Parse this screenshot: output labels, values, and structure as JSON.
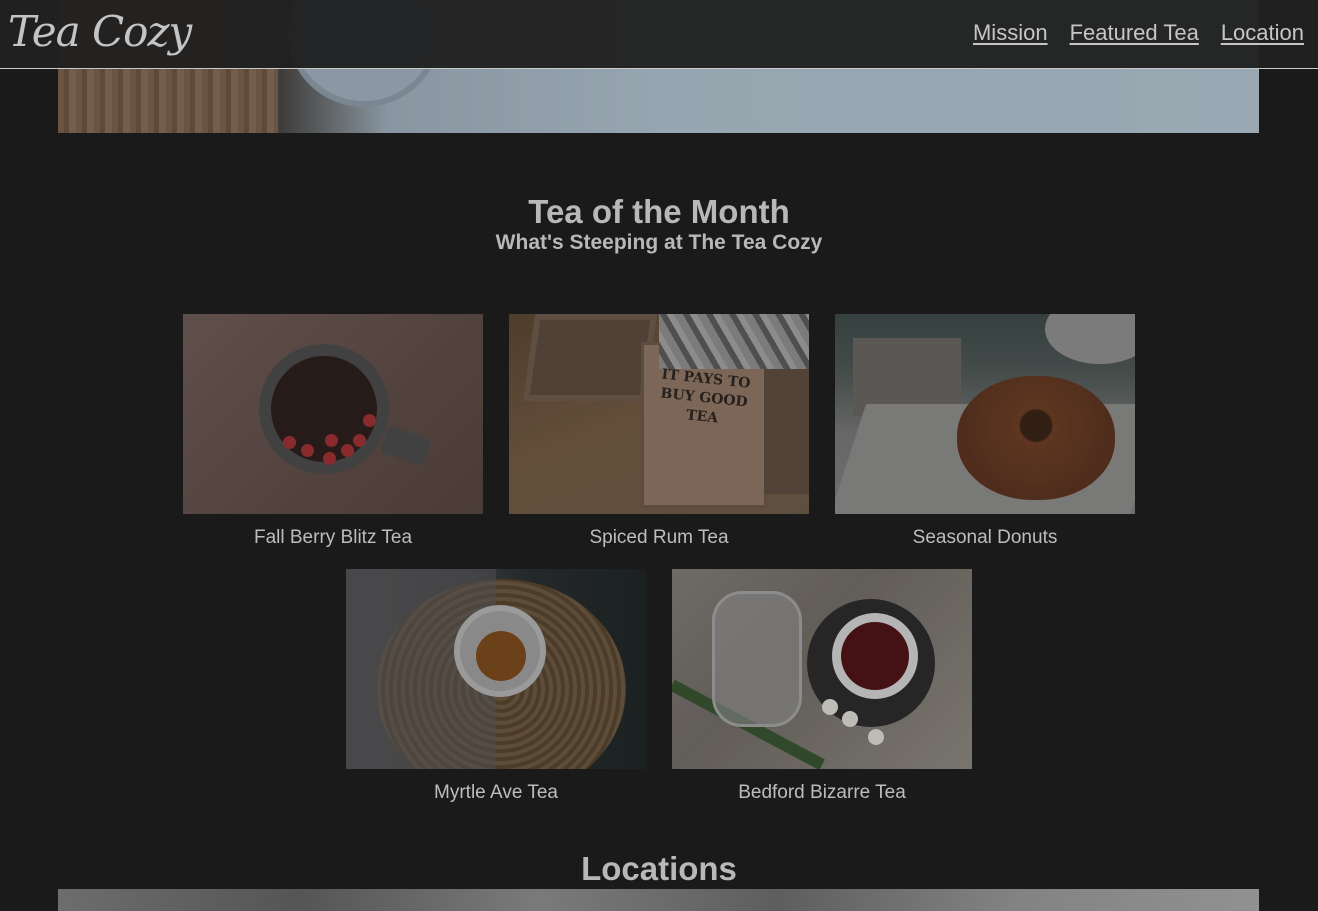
{
  "header": {
    "logo": "Tea Cozy",
    "nav": [
      {
        "label": "Mission"
      },
      {
        "label": "Featured Tea"
      },
      {
        "label": "Location"
      }
    ]
  },
  "tea_of_month": {
    "title": "Tea of the Month",
    "subtitle": "What's Steeping at The Tea Cozy",
    "items": [
      {
        "caption": "Fall Berry Blitz Tea"
      },
      {
        "caption": "Spiced Rum Tea",
        "box_text": "IT PAYS TO BUY GOOD TEA"
      },
      {
        "caption": "Seasonal Donuts"
      },
      {
        "caption": "Myrtle Ave Tea"
      },
      {
        "caption": "Bedford Bizarre Tea"
      }
    ]
  },
  "locations": {
    "title": "Locations"
  },
  "colors": {
    "background": "#1a1a1a",
    "header": "#202020",
    "text": "#b3b3b3"
  }
}
